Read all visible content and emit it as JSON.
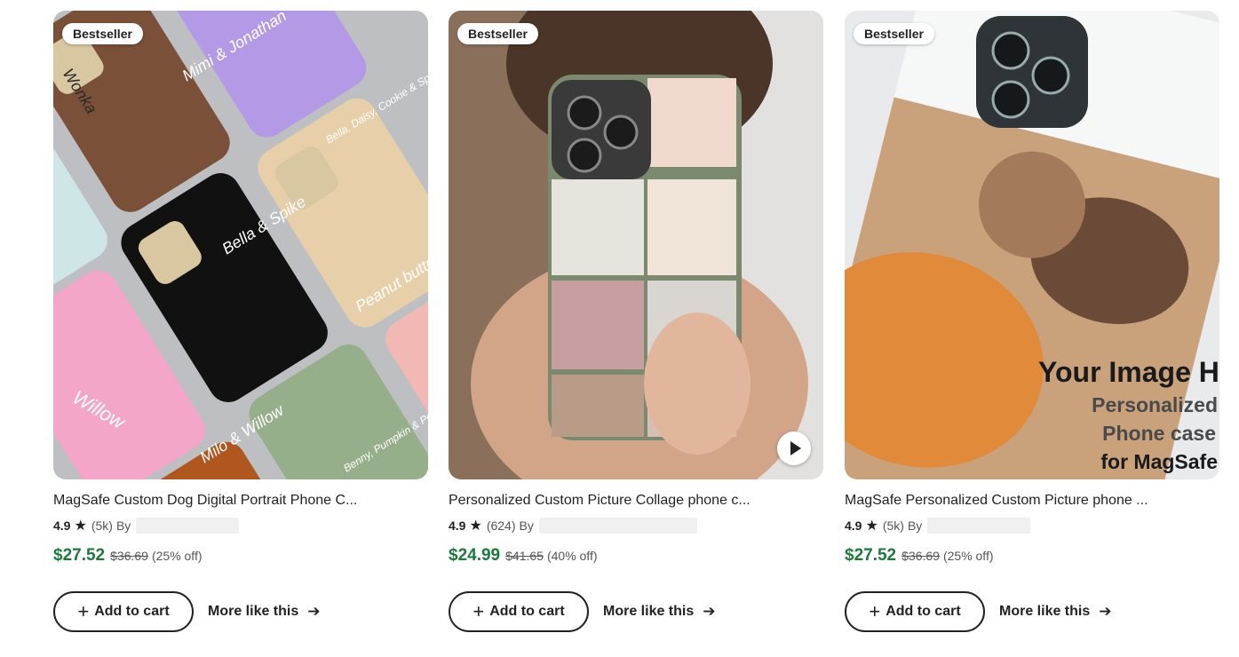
{
  "products": [
    {
      "badge": "Bestseller",
      "title": "MagSafe Custom Dog Digital Portrait Phone C...",
      "rating": "4.9",
      "reviews": "(5k)",
      "by": "By",
      "price": "$27.52",
      "original_price": "$36.69",
      "discount": "(25% off)",
      "add_to_cart": "Add to cart",
      "more_like_this": "More like this",
      "image_texts": [
        "Wonka",
        "Mimi & Jonathan",
        "Bella, Daisy, Cookie & Spike",
        "Bella & Spike",
        "Peanut butter",
        "Willow",
        "Milo & Willow",
        "Benny, Pumpkin & Pocky"
      ]
    },
    {
      "badge": "Bestseller",
      "title": "Personalized Custom Picture Collage phone c...",
      "rating": "4.9",
      "reviews": "(624)",
      "by": "By",
      "price": "$24.99",
      "original_price": "$41.65",
      "discount": "(40% off)",
      "add_to_cart": "Add to cart",
      "more_like_this": "More like this"
    },
    {
      "badge": "Bestseller",
      "title": "MagSafe Personalized Custom Picture phone ...",
      "rating": "4.9",
      "reviews": "(5k)",
      "by": "By",
      "price": "$27.52",
      "original_price": "$36.69",
      "discount": "(25% off)",
      "add_to_cart": "Add to cart",
      "more_like_this": "More like this",
      "image_texts": [
        "Your Image H",
        "Personalized",
        "Phone case",
        "for MagSafe"
      ]
    }
  ],
  "colors": {
    "price": "#1a7a3c",
    "text": "#222222"
  }
}
